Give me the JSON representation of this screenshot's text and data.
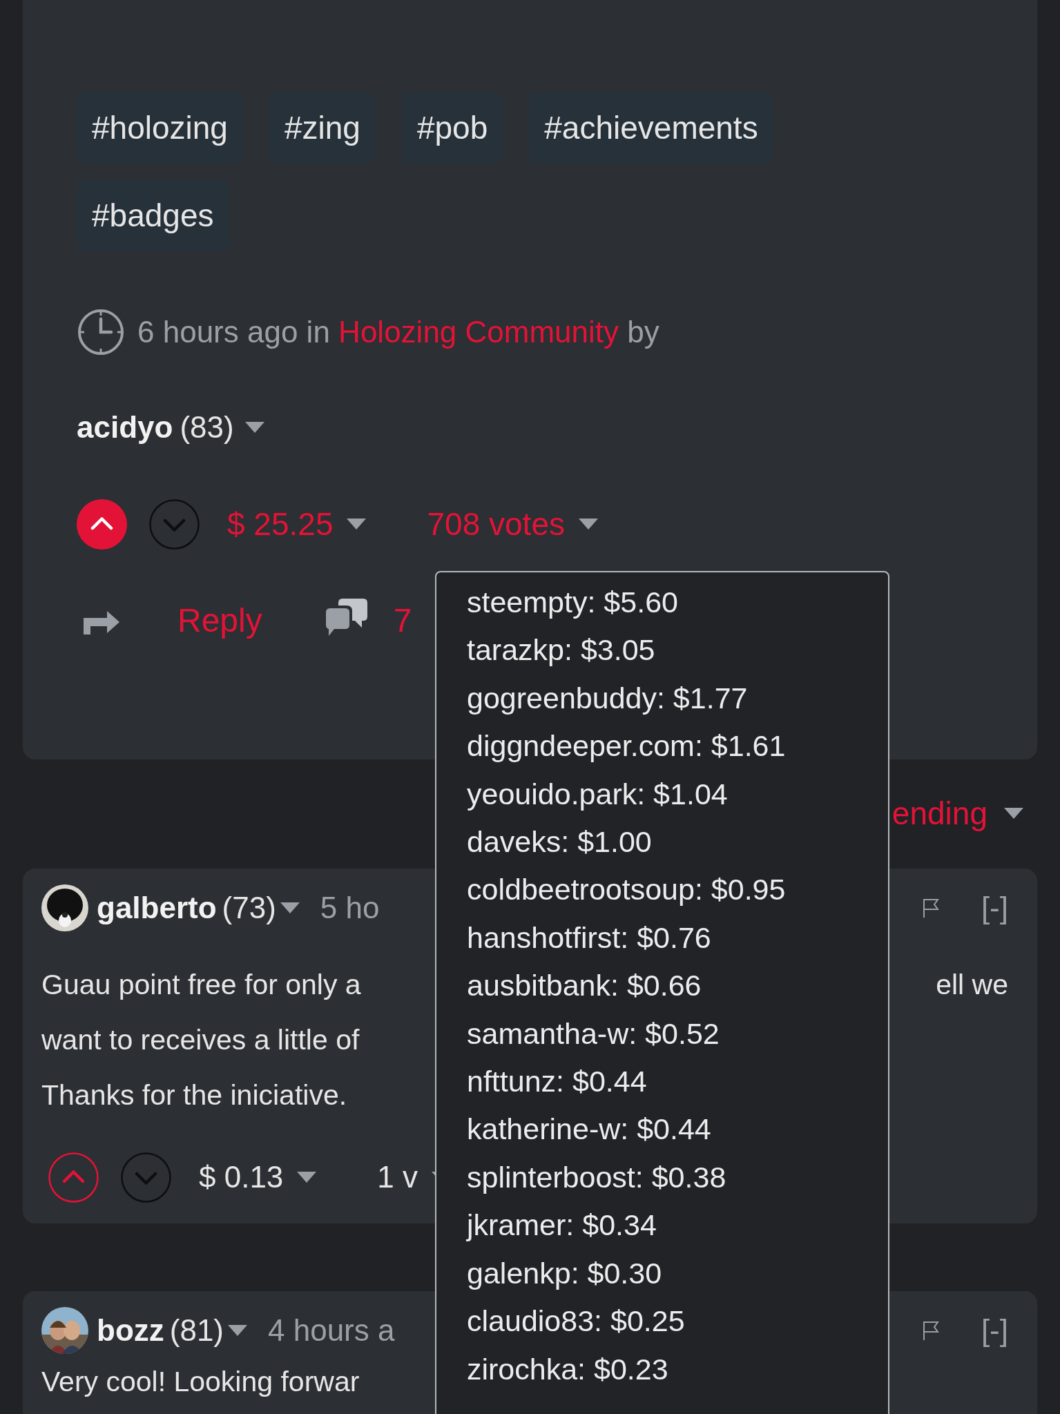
{
  "post": {
    "tags": [
      "#holozing",
      "#zing",
      "#pob",
      "#achievements",
      "#badges"
    ],
    "meta": {
      "time": "6 hours ago in",
      "community": "Holozing Community",
      "by": "by"
    },
    "author": {
      "name": "acidyo",
      "reputation": "(83)"
    },
    "vote": {
      "upvoted": true,
      "highlighted": true,
      "payout": "$ 25.25",
      "votes": "708 votes"
    },
    "actions": {
      "reply": "Reply",
      "comments": "7"
    }
  },
  "sort": {
    "label": "ending"
  },
  "comments": [
    {
      "author": "galberto",
      "reputation": "(73)",
      "time": "5 ho",
      "collapse": "[-]",
      "avatar": {
        "kind": "picture"
      },
      "lines": [
        {
          "left": "Guau point free for only a",
          "right": "ell we"
        },
        {
          "left": "want to receives a little of"
        },
        {
          "left": "Thanks for the iniciative."
        }
      ],
      "vote": {
        "upvoted": false,
        "highlighted": false,
        "payout": "$ 0.13",
        "votes": "1 v"
      }
    },
    {
      "author": "bozz",
      "reputation": "(81)",
      "time": "4 hours a",
      "collapse": "[-]",
      "avatar": {
        "kind": "picture"
      },
      "lines": [
        {
          "left": "Very cool! Looking forwar"
        }
      ]
    }
  ],
  "vote_popup": {
    "entries": [
      "steempty: $5.60",
      "tarazkp: $3.05",
      "gogreenbuddy: $1.77",
      "diggndeeper.com: $1.61",
      "yeouido.park: $1.04",
      "daveks: $1.00",
      "coldbeetrootsoup: $0.95",
      "hanshotfirst: $0.76",
      "ausbitbank: $0.66",
      "samantha-w: $0.52",
      "nfttunz: $0.44",
      "katherine-w: $0.44",
      "splinterboost: $0.38",
      "jkramer: $0.34",
      "galenkp: $0.30",
      "claudio83: $0.25",
      "zirochka: $0.23"
    ]
  }
}
